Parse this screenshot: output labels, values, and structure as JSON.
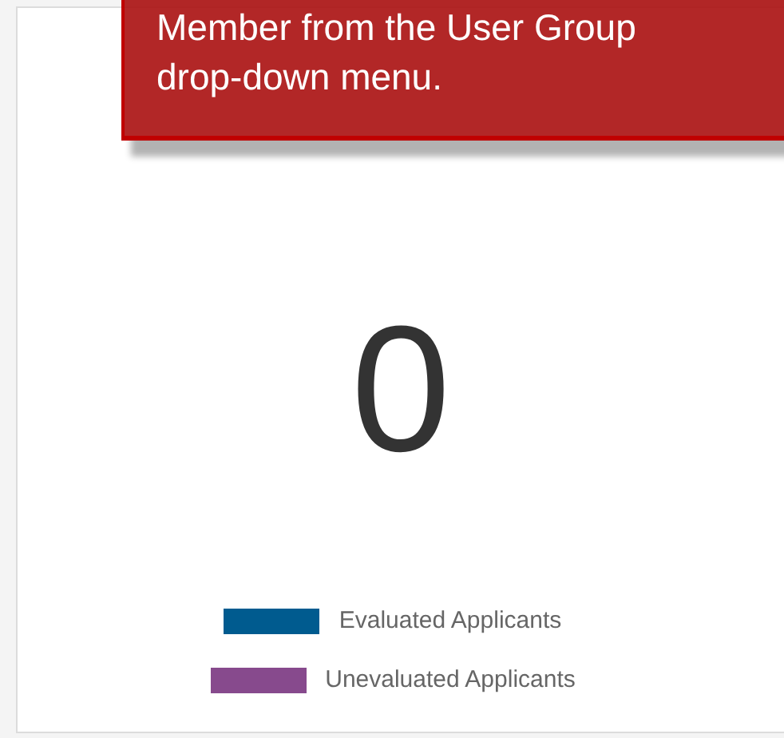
{
  "card": {
    "value": "0",
    "legend": [
      {
        "label": "Evaluated Applicants",
        "color": "#005b8f"
      },
      {
        "label": "Unevaluated Applicants",
        "color": "#874a8d"
      }
    ]
  },
  "callout": {
    "text": "Member from the User Group drop-down menu."
  }
}
